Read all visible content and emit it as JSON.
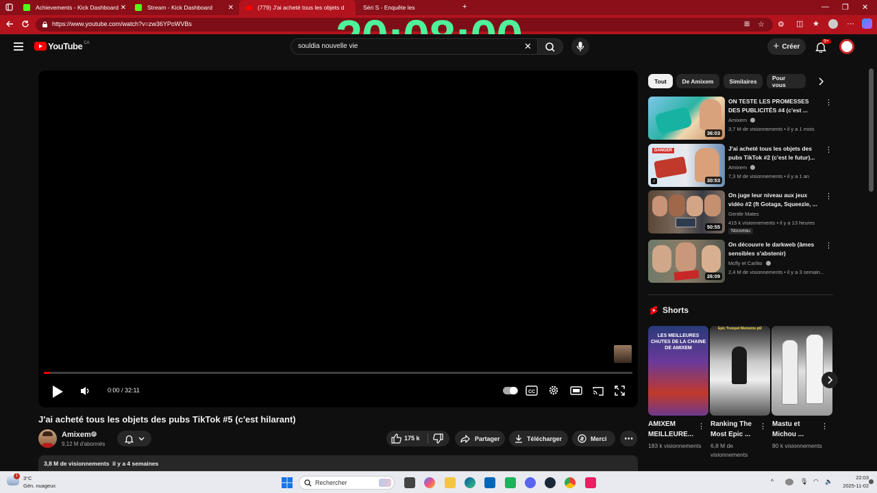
{
  "browser": {
    "tabs": [
      {
        "title": "Achievements - Kick Dashboard"
      },
      {
        "title": "Stream - Kick Dashboard"
      },
      {
        "title": "(779) J'ai acheté tous les objets d"
      },
      {
        "title": "Séri     S - Enquête      les"
      }
    ],
    "url": "https://www.youtube.com/watch?v=zw36YPoWVBs",
    "overlay_clock": "20:08:00",
    "colors": {
      "frame": "#b3131d",
      "clock": "#4ef29a"
    }
  },
  "header": {
    "logo_text": "YouTube",
    "region": "CA",
    "search_value": "souldia nouvelle vie",
    "create_label": "Créer",
    "notif_count": "9+"
  },
  "player": {
    "time": "0:00 / 32:11",
    "progress": 0.01
  },
  "video": {
    "title": "J'ai acheté tous les objets des pubs TikTok #5 (c'est hilarant)",
    "channel": "Amixem",
    "subscribers": "9,12 M d'abonnés",
    "likes": "175 k",
    "share_label": "Partager",
    "download_label": "Télécharger",
    "thanks_label": "Merci",
    "views": "3,8 M de visionnements",
    "age": "il y a 4 semaines"
  },
  "chips": [
    "Tout",
    "De Amixem",
    "Similaires",
    "Pour vous"
  ],
  "recommendations": [
    {
      "title": "ON TESTE LES PROMESSES DES PUBLICITÉS #4 (c'est ...",
      "channel": "Amixem",
      "meta": "3,7 M de visionnements • il y a 1 mois",
      "duration": "36:03"
    },
    {
      "title": "J'ai acheté tous les objets des pubs TikTok #2 (c'est le futur)...",
      "channel": "Amixem",
      "meta": "7,3 M de visionnements • il y a 1 an",
      "duration": "30:53"
    },
    {
      "title": "On juge leur niveau aux jeux vidéo #2 (ft Gotaga, Squeezie, ...",
      "channel": "Gentle Mates",
      "meta": "415 k visionnements • il y a 13 heures",
      "duration": "50:55",
      "badge": "Nouveau"
    },
    {
      "title": "On découvre le darkweb (âmes sensibles s'abstenir)",
      "channel": "Mcfly et Carlito",
      "meta": "2,4 M de visionnements • il y a 3 semain...",
      "duration": "26:09"
    }
  ],
  "shorts": {
    "heading": "Shorts",
    "items": [
      {
        "title1": "AMIXEM",
        "title2": "MEILLEURE...",
        "meta1": "183 k visionnements",
        "meta2": "",
        "thumb_text": "LES MEILLEURES CHUTES DE LA CHAINE DE AMIXEM"
      },
      {
        "title1": "Ranking The",
        "title2": "Most Epic ...",
        "meta1": "6,8 M de",
        "meta2": "visionnements",
        "thumb_text": "Epic Trumpet Moments pt2"
      },
      {
        "title1": "Mastu et",
        "title2": "Michou ...",
        "meta1": "80 k visionnements",
        "meta2": "",
        "thumb_text": ""
      }
    ]
  },
  "taskbar": {
    "search_label": "Rechercher",
    "weather_temp": "3°C",
    "weather_desc": "Gén. nuageux",
    "time": "22:03",
    "date": "2025-11-02"
  }
}
